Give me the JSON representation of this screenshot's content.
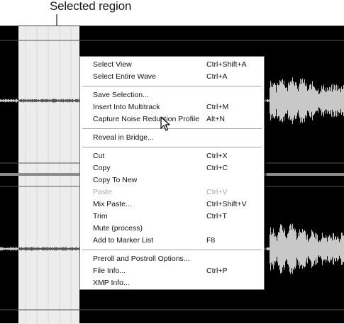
{
  "callout": {
    "label": "Selected region"
  },
  "menu": {
    "groups": [
      [
        {
          "label": "Select View",
          "shortcut": "Ctrl+Shift+A"
        },
        {
          "label": "Select Entire Wave",
          "shortcut": "Ctrl+A"
        }
      ],
      [
        {
          "label": "Save Selection...",
          "shortcut": ""
        },
        {
          "label": "Insert Into Multitrack",
          "shortcut": "Ctrl+M"
        },
        {
          "label": "Capture Noise Reduction Profile",
          "shortcut": "Alt+N"
        }
      ],
      [
        {
          "label": "Reveal in Bridge...",
          "shortcut": ""
        }
      ],
      [
        {
          "label": "Cut",
          "shortcut": "Ctrl+X"
        },
        {
          "label": "Copy",
          "shortcut": "Ctrl+C"
        },
        {
          "label": "Copy To New",
          "shortcut": ""
        },
        {
          "label": "Paste",
          "shortcut": "Ctrl+V",
          "disabled": true
        },
        {
          "label": "Mix Paste...",
          "shortcut": "Ctrl+Shift+V"
        },
        {
          "label": "Trim",
          "shortcut": "Ctrl+T"
        },
        {
          "label": "Mute (process)",
          "shortcut": ""
        },
        {
          "label": "Add to Marker List",
          "shortcut": "F8"
        }
      ],
      [
        {
          "label": "Preroll and Postroll Options...",
          "shortcut": ""
        },
        {
          "label": "File Info...",
          "shortcut": "Ctrl+P"
        },
        {
          "label": "XMP Info...",
          "shortcut": ""
        }
      ]
    ]
  },
  "colors": {
    "waveform": "#c8c8c8",
    "selection": "#ececec",
    "background": "#000000"
  }
}
